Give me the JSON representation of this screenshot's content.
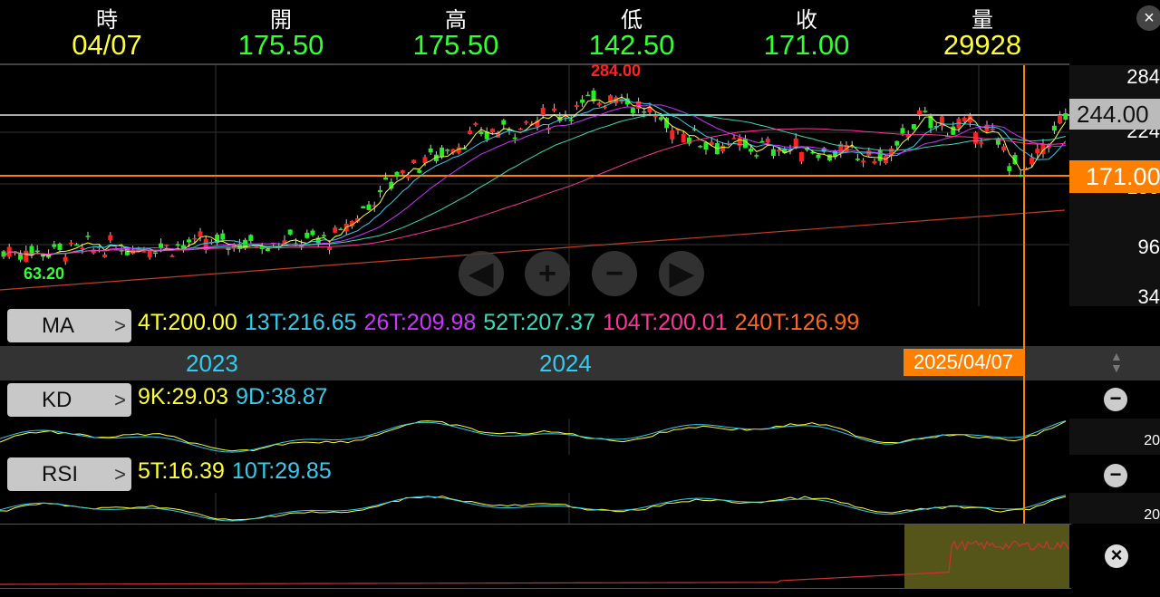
{
  "header": {
    "labels": [
      "時",
      "開",
      "高",
      "低",
      "收",
      "量"
    ],
    "values": [
      {
        "v": "04/07",
        "c": "#ffff33"
      },
      {
        "v": "175.50",
        "c": "#33ff33"
      },
      {
        "v": "175.50",
        "c": "#33ff33"
      },
      {
        "v": "142.50",
        "c": "#33ff33"
      },
      {
        "v": "171.00",
        "c": "#33ff33"
      },
      {
        "v": "29928",
        "c": "#ffff33"
      }
    ],
    "close_label": "×"
  },
  "chart": {
    "high_label": "284.00",
    "low_label": "63.20",
    "axis": [
      "284",
      "224",
      "159",
      "96",
      "34"
    ],
    "marker_gray": "244.00",
    "marker_orange": "171.00"
  },
  "nav": {
    "prev": "◀",
    "zoom_in": "+",
    "zoom_out": "−",
    "next": "▶"
  },
  "ma": {
    "label": "MA",
    "items": [
      {
        "t": "4T:200.00",
        "c": "#ffff33"
      },
      {
        "t": "13T:216.65",
        "c": "#33ccee"
      },
      {
        "t": "26T:209.98",
        "c": "#cc33ff"
      },
      {
        "t": "52T:207.37",
        "c": "#33ddbb"
      },
      {
        "t": "104T:200.01",
        "c": "#ff3399"
      },
      {
        "t": "240T:126.99",
        "c": "#ff6622"
      }
    ]
  },
  "timeline": {
    "years": [
      "2023",
      "2024"
    ],
    "cursor_date": "2025/04/07"
  },
  "kd": {
    "label": "KD",
    "items": [
      {
        "t": "9K:29.03",
        "c": "#ffff33"
      },
      {
        "t": "9D:38.87",
        "c": "#33ccee"
      }
    ],
    "axis": "20"
  },
  "rsi": {
    "label": "RSI",
    "items": [
      {
        "t": "5T:16.39",
        "c": "#ffff33"
      },
      {
        "t": "10T:29.85",
        "c": "#33ccee"
      }
    ],
    "axis": "20"
  },
  "colors": {
    "up": "#ff2222",
    "down": "#22ee22",
    "cursor": "#ff8800"
  }
}
